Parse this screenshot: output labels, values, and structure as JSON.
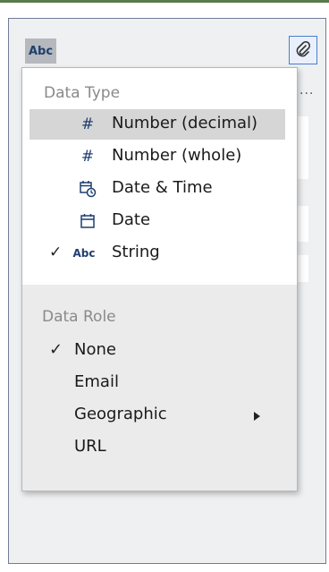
{
  "header": {
    "type_button_label": "Abc",
    "attach_icon": "paperclip-icon",
    "more_icon": "more-icon",
    "more_label": "..."
  },
  "menu": {
    "data_type": {
      "label": "Data Type",
      "items": [
        {
          "label": "Number (decimal)",
          "icon": "hash-icon",
          "glyph": "#",
          "checked": false,
          "highlighted": true
        },
        {
          "label": "Number (whole)",
          "icon": "hash-icon",
          "glyph": "#",
          "checked": false,
          "highlighted": false
        },
        {
          "label": "Date & Time",
          "icon": "datetime-icon",
          "glyph": "",
          "checked": false,
          "highlighted": false
        },
        {
          "label": "Date",
          "icon": "calendar-icon",
          "glyph": "",
          "checked": false,
          "highlighted": false
        },
        {
          "label": "String",
          "icon": "abc-icon",
          "glyph": "Abc",
          "checked": true,
          "highlighted": false
        }
      ]
    },
    "data_role": {
      "label": "Data Role",
      "items": [
        {
          "label": "None",
          "checked": true,
          "has_submenu": false
        },
        {
          "label": "Email",
          "checked": false,
          "has_submenu": false
        },
        {
          "label": "Geographic",
          "checked": false,
          "has_submenu": true
        },
        {
          "label": "URL",
          "checked": false,
          "has_submenu": false
        }
      ]
    },
    "check_glyph": "✓"
  },
  "colors": {
    "panel_border": "#6e7d96",
    "icon_blue": "#1f3f6e",
    "highlight": "#d6d6d6",
    "attach_border": "#4a7fcb"
  }
}
